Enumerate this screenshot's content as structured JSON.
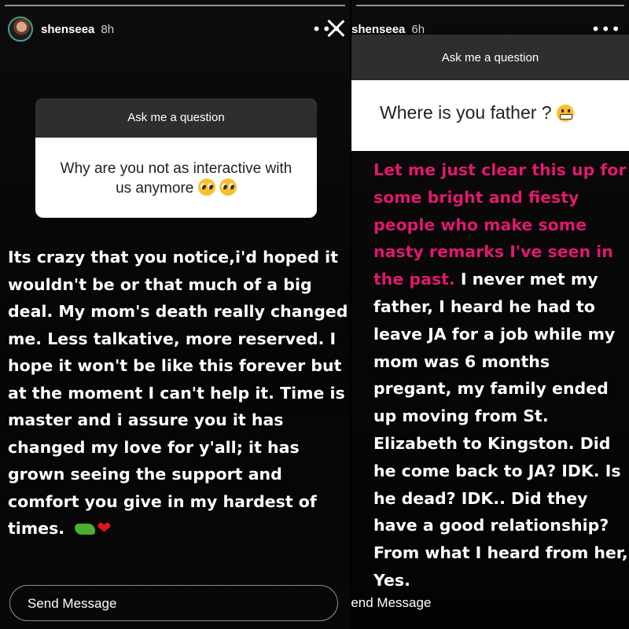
{
  "stories": [
    {
      "username": "shenseea",
      "time": "8h",
      "more_icon": "•••",
      "question_header": "Ask me a question",
      "question": "Why are you not as interactive with us anymore",
      "answer": "Its crazy that you notice,i'd hoped it wouldn't be or that much of a big deal. My mom's death really changed me. Less talkative, more reserved. I hope it won't be like this forever but at the moment I can't help it. Time is master and i assure you it has changed my love for y'all; it has grown seeing the support and comfort you give in my hardest of times.",
      "send_placeholder": "Send Message"
    },
    {
      "username": "shenseea",
      "time": "6h",
      "more_icon": "•••",
      "question_header": "Ask me a question",
      "question": "Where is you father ?",
      "answer_highlight": "Let me just clear this up for some bright and fiesty people who make some nasty remarks I've seen in the past.",
      "answer": "I never met my father, I heard he had to leave JA for a job while my mom was 6 months pregant, my family ended up moving from St. Elizabeth to Kingston. Did he come back to JA? IDK. Is he dead? IDK.. Did they have a good relationship? From what I heard from her, Yes.",
      "send_placeholder": "Send Message"
    }
  ],
  "colors": {
    "highlight": "#e0196f",
    "background": "#000000",
    "card_header": "#2e2e2e"
  }
}
